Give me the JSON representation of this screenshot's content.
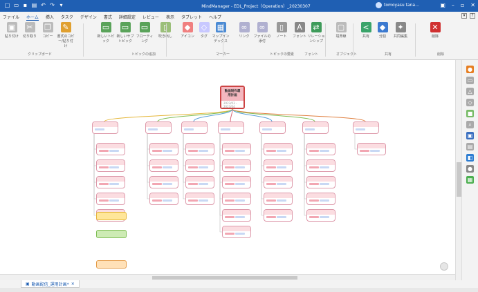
{
  "titlebar": {
    "title": "MindManager - EDL_Project（Operation）_20230307",
    "user": "tomoyasu tana…"
  },
  "menu": {
    "tabs": [
      "ファイル",
      "ホーム",
      "挿入",
      "タスク",
      "デザイン",
      "書式",
      "詳細設定",
      "レビュー",
      "表示",
      "タブレット",
      "ヘルプ"
    ],
    "active": "ホーム"
  },
  "ribbon": {
    "buttons": [
      "貼り付け",
      "切り取り",
      "コピー",
      "書式のコピー/貼り付け",
      "新しいトピック",
      "新しいサブトピック",
      "フローティング",
      "吹き出し",
      "アイコン",
      "タグ",
      "マップインデックス",
      "リンク",
      "ファイルの添付",
      "ノート",
      "フォント",
      "リレーションシップ",
      "境界線",
      "共有",
      "分割",
      "共同編集",
      "削除"
    ],
    "groups": [
      "クリップボード",
      "トピックの追加",
      "マーカー",
      "トピックの要素",
      "フォント",
      "オブジェクト",
      "共有",
      "削除"
    ]
  },
  "map": {
    "central": "動画制作運用計画",
    "central_sub": "2023/03 - 2023/04"
  },
  "doctab": {
    "label": "動画配信_運用計画*"
  },
  "colors": {
    "accent": "#1f5fb3",
    "topic": "#f4b8bf"
  }
}
